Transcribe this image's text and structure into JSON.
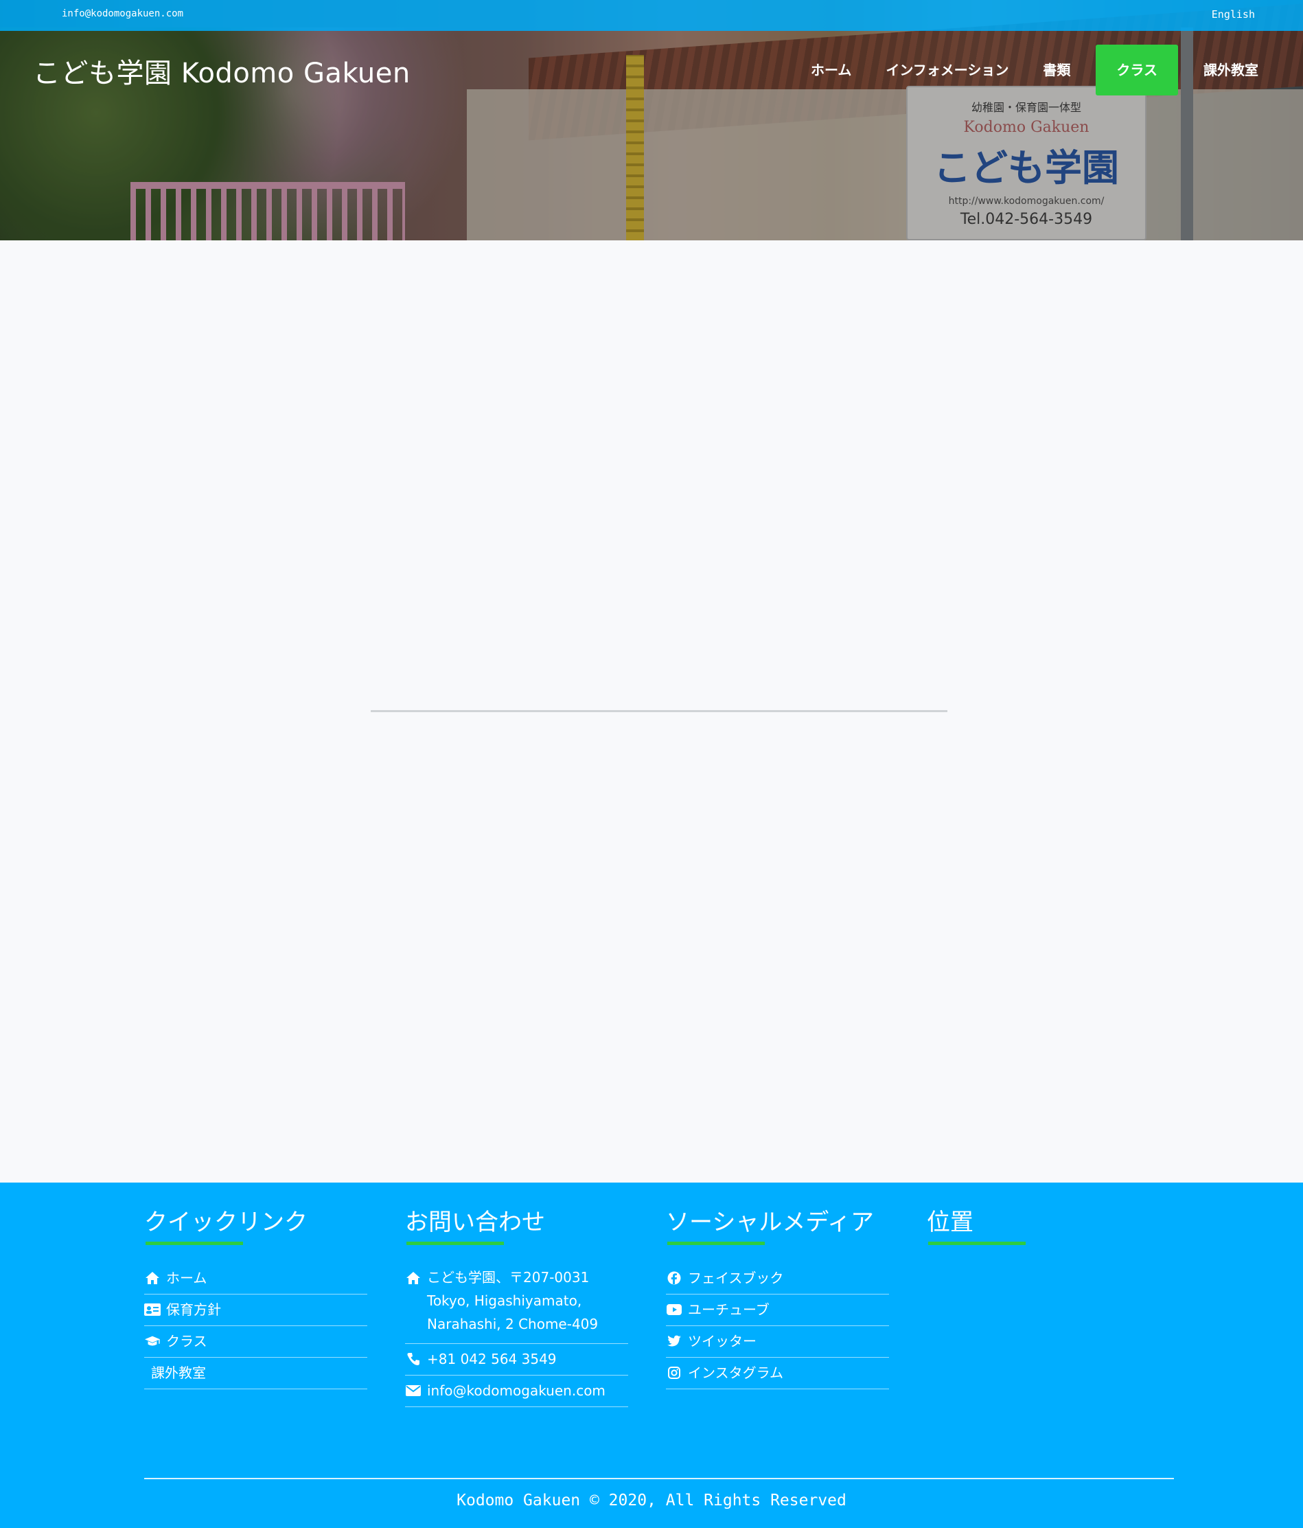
{
  "topbar": {
    "email": "info@kodomogakuen.com",
    "language": "English"
  },
  "header": {
    "brand": "こども学園 Kodomo Gakuen",
    "nav": [
      {
        "label": "ホーム",
        "active": false
      },
      {
        "label": "インフォメーション",
        "active": false
      },
      {
        "label": "書類",
        "active": false
      },
      {
        "label": "クラス",
        "active": true
      },
      {
        "label": "課外教室",
        "active": false
      }
    ]
  },
  "hero_sign": {
    "small": "幼稚園・保育園一体型",
    "roman": "Kodomo Gakuen",
    "big": "こども学園",
    "url": "http://www.kodomogakuen.com/",
    "tel": "Tel.042-564-3549"
  },
  "footer": {
    "quick_links": {
      "title": "クイックリンク",
      "items": [
        {
          "icon": "home-icon",
          "label": "ホーム"
        },
        {
          "icon": "id-card-icon",
          "label": "保育方針"
        },
        {
          "icon": "graduation-cap-icon",
          "label": "クラス"
        },
        {
          "icon": "",
          "label": "課外教室"
        }
      ]
    },
    "contact": {
      "title": "お問い合わせ",
      "address_lines": [
        "こども学園、〒207-0031",
        "Tokyo, Higashiyamato,",
        "Narahashi, 2 Chome-409"
      ],
      "phone": "+81 042 564 3549",
      "email": "info@kodomogakuen.com"
    },
    "social": {
      "title": "ソーシャルメディア",
      "items": [
        {
          "icon": "facebook-icon",
          "label": "フェイスブック"
        },
        {
          "icon": "youtube-icon",
          "label": "ユーチューブ"
        },
        {
          "icon": "twitter-icon",
          "label": "ツイッター"
        },
        {
          "icon": "instagram-icon",
          "label": "インスタグラム"
        }
      ]
    },
    "location": {
      "title": "位置"
    },
    "copyright": "Kodomo Gakuen © 2020, All Rights Reserved"
  },
  "colors": {
    "primary_blue": "#00aeff",
    "accent_green": "#2ecc40",
    "page_bg": "#f8f9fb"
  }
}
